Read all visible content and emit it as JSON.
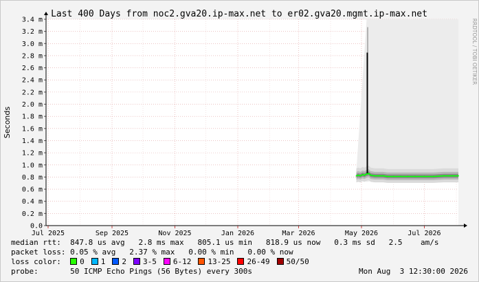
{
  "chart_data": {
    "type": "area",
    "title": "Last 400 Days from noc2.gva20.ip-max.net to er02.gva20.mgmt.ip-max.net",
    "ylabel": "Seconds",
    "watermark": "RRDTOOL / TOBI OETIKER",
    "ylim": [
      0,
      0.0034
    ],
    "y_ticks": [
      {
        "value": 0.0,
        "label": "0.0"
      },
      {
        "value": 0.0002,
        "label": "0.2 m"
      },
      {
        "value": 0.0004,
        "label": "0.4 m"
      },
      {
        "value": 0.0006,
        "label": "0.6 m"
      },
      {
        "value": 0.0008,
        "label": "0.8 m"
      },
      {
        "value": 0.001,
        "label": "1.0 m"
      },
      {
        "value": 0.0012,
        "label": "1.2 m"
      },
      {
        "value": 0.0014,
        "label": "1.4 m"
      },
      {
        "value": 0.0016,
        "label": "1.6 m"
      },
      {
        "value": 0.0018,
        "label": "1.8 m"
      },
      {
        "value": 0.002,
        "label": "2.0 m"
      },
      {
        "value": 0.0022,
        "label": "2.2 m"
      },
      {
        "value": 0.0024,
        "label": "2.4 m"
      },
      {
        "value": 0.0026,
        "label": "2.6 m"
      },
      {
        "value": 0.0028,
        "label": "2.8 m"
      },
      {
        "value": 0.003,
        "label": "3.0 m"
      },
      {
        "value": 0.0032,
        "label": "3.2 m"
      },
      {
        "value": 0.0034,
        "label": "3.4 m"
      }
    ],
    "xlim": [
      "2025-06-29",
      "2026-08-03"
    ],
    "x_ticks": [
      {
        "date": "2025-07-01",
        "label": "Jul 2025"
      },
      {
        "date": "2025-09-01",
        "label": "Sep 2025"
      },
      {
        "date": "2025-11-01",
        "label": "Nov 2025"
      },
      {
        "date": "2026-01-01",
        "label": "Jan 2026"
      },
      {
        "date": "2026-03-01",
        "label": "Mar 2026"
      },
      {
        "date": "2026-05-01",
        "label": "May 2026"
      },
      {
        "date": "2026-07-01",
        "label": "Jul 2026"
      }
    ],
    "x_minor_ticks": [
      "2025-08-01",
      "2025-10-01",
      "2025-12-01",
      "2026-02-01",
      "2026-04-01",
      "2026-06-01",
      "2026-08-01"
    ],
    "grid": true,
    "data_start": "2026-04-26",
    "median_line": {
      "color": "#00ff00",
      "points": [
        [
          "2026-04-26",
          0.00082
        ],
        [
          "2026-04-28",
          0.00083
        ],
        [
          "2026-04-30",
          0.00082
        ],
        [
          "2026-05-02",
          0.00084
        ],
        [
          "2026-05-04",
          0.00083
        ],
        [
          "2026-05-06",
          0.00085
        ],
        [
          "2026-05-08",
          0.00086
        ],
        [
          "2026-05-10",
          0.00083
        ],
        [
          "2026-05-14",
          0.00082
        ],
        [
          "2026-05-18",
          0.00082
        ],
        [
          "2026-05-22",
          0.00082
        ],
        [
          "2026-05-26",
          0.00081
        ],
        [
          "2026-06-01",
          0.00081
        ],
        [
          "2026-06-08",
          0.00081
        ],
        [
          "2026-06-15",
          0.00081
        ],
        [
          "2026-06-22",
          0.00081
        ],
        [
          "2026-07-01",
          0.00081
        ],
        [
          "2026-07-10",
          0.00081
        ],
        [
          "2026-07-20",
          0.00082
        ],
        [
          "2026-07-28",
          0.00082
        ],
        [
          "2026-08-03",
          0.00082
        ]
      ]
    },
    "ping_envelope": [
      [
        "2026-04-26",
        0.0008,
        0.0009
      ],
      [
        "2026-05-06",
        0.00072,
        0.0034
      ],
      [
        "2026-05-15",
        0.00075,
        0.0034
      ],
      [
        "2026-06-01",
        0.00076,
        0.0034
      ],
      [
        "2026-07-01",
        0.00076,
        0.0034
      ],
      [
        "2026-08-03",
        0.00076,
        0.0034
      ]
    ],
    "spike": {
      "date": "2026-05-07",
      "max": 0.00327,
      "mid": 0.00285
    }
  },
  "stats": {
    "rtt_label": "median rtt:",
    "rtt_values": "  847.8 us avg   2.8 ms max   805.1 us min   818.9 us now   0.3 ms sd   2.5    am/s",
    "loss_label": "packet loss:",
    "loss_values": " 0.05 % avg   2.37 % max   0.00 % min   0.00 % now",
    "color_label": "loss color:",
    "probe_label": "probe:",
    "probe_values": "       50 ICMP Echo Pings (56 Bytes) every 300s",
    "timestamp": "Mon Aug  3 12:30:00 2026"
  },
  "loss_colors": [
    {
      "label": "0",
      "color": "#26ff00"
    },
    {
      "label": "1",
      "color": "#00b8ff"
    },
    {
      "label": "2",
      "color": "#0059ff"
    },
    {
      "label": "3-5",
      "color": "#7e00ff"
    },
    {
      "label": "6-12",
      "color": "#ff00ff"
    },
    {
      "label": "13-25",
      "color": "#ff5500"
    },
    {
      "label": "26-49",
      "color": "#ff0000"
    },
    {
      "label": "50/50",
      "color": "#a10000"
    }
  ]
}
